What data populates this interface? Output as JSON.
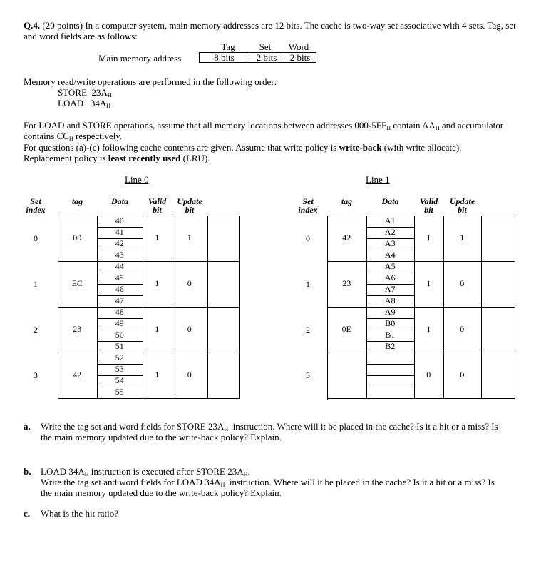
{
  "question": {
    "number": "Q.4.",
    "intro": "(20 points) In a computer system, main memory addresses are 12 bits. The cache is two-way set associative with 4 sets. Tag, set and word fields are as follows:"
  },
  "address_format": {
    "label": "Main memory address",
    "fields": [
      {
        "name": "Tag",
        "bits": "8 bits"
      },
      {
        "name": "Set",
        "bits": "2 bits"
      },
      {
        "name": "Word",
        "bits": "2 bits"
      }
    ]
  },
  "operations": {
    "intro": "Memory read/write operations are performed in the following order:",
    "list": [
      {
        "op": "STORE",
        "addr": "23A",
        "suffix": "H"
      },
      {
        "op": "LOAD",
        "addr": "34A",
        "suffix": "H"
      }
    ]
  },
  "assumptions": {
    "p1_a": "For LOAD and STORE operations, assume that all memory locations between addresses 000-5FF",
    "p1_b": " contain AA",
    "p1_c": " and accumulator contains CC",
    "p1_d": " respectively.",
    "p2_a": "For questions (a)-(c) following cache contents are given. Assume that write policy is ",
    "p2_bold": "write-back",
    "p2_b": " (with write allocate).",
    "p3_a": "Replacement policy is ",
    "p3_bold": "least recently used",
    "p3_b": " (LRU).",
    "sub": "H"
  },
  "headers": {
    "set_index_1": "Set",
    "set_index_2": "index",
    "tag": "tag",
    "data": "Data",
    "valid_1": "Valid",
    "valid_2": "bit",
    "update_1": "Update",
    "update_2": "bit"
  },
  "cache": {
    "line0": {
      "title": "Line 0",
      "sets": [
        {
          "index": "0",
          "tag": "00",
          "data": [
            "40",
            "41",
            "42",
            "43"
          ],
          "valid": "1",
          "update": "1"
        },
        {
          "index": "1",
          "tag": "EC",
          "data": [
            "44",
            "45",
            "46",
            "47"
          ],
          "valid": "1",
          "update": "0"
        },
        {
          "index": "2",
          "tag": "23",
          "data": [
            "48",
            "49",
            "50",
            "51"
          ],
          "valid": "1",
          "update": "0"
        },
        {
          "index": "3",
          "tag": "42",
          "data": [
            "52",
            "53",
            "54",
            "55"
          ],
          "valid": "1",
          "update": "0"
        }
      ]
    },
    "line1": {
      "title": "Line 1",
      "sets": [
        {
          "index": "0",
          "tag": "42",
          "data": [
            "A1",
            "A2",
            "A3",
            "A4"
          ],
          "valid": "1",
          "update": "1"
        },
        {
          "index": "1",
          "tag": "23",
          "data": [
            "A5",
            "A6",
            "A7",
            "A8"
          ],
          "valid": "1",
          "update": "0"
        },
        {
          "index": "2",
          "tag": "0E",
          "data": [
            "A9",
            "B0",
            "B1",
            "B2"
          ],
          "valid": "1",
          "update": "0"
        },
        {
          "index": "3",
          "tag": "",
          "data": [
            "",
            "",
            "",
            ""
          ],
          "valid": "0",
          "update": "0"
        }
      ]
    }
  },
  "questions": {
    "a": {
      "label": "a.",
      "l1_a": "Write the tag set and word fields for STORE 23A",
      "l1_b": "  instruction. Where will it be placed in the cache? Is it a hit or a miss? Is",
      "l2": "the main memory updated due to the write-back policy? Explain."
    },
    "b": {
      "label": "b.",
      "l0_a": "LOAD 34A",
      "l0_b": " instruction is executed after STORE 23A",
      "l0_c": ".",
      "l1_a": "Write the tag set and word fields for LOAD 34A",
      "l1_b": "  instruction. Where will it be placed in the cache? Is it a hit or a miss? Is",
      "l2": "the main memory updated due to the write-back policy? Explain."
    },
    "c": {
      "label": "c.",
      "text": "What is the hit ratio?"
    },
    "sub": "H"
  }
}
